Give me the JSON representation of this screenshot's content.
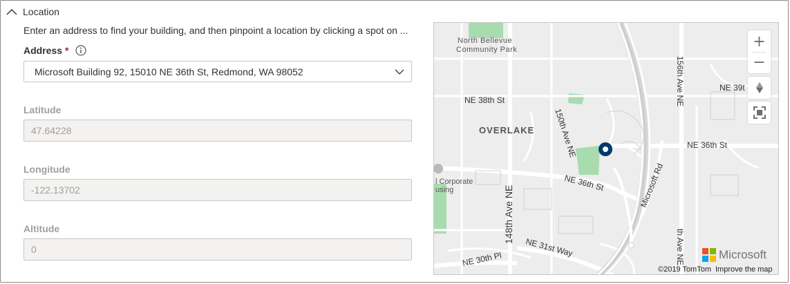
{
  "section": {
    "title": "Location",
    "expanded": true
  },
  "instructions": "Enter an address to find your building, and then pinpoint a location by clicking a spot on ...",
  "address": {
    "label": "Address",
    "required_mark": "*",
    "value": "Microsoft Building 92, 15010 NE 36th St, Redmond, WA 98052"
  },
  "latitude": {
    "label": "Latitude",
    "value": "47.64228"
  },
  "longitude": {
    "label": "Longitude",
    "value": "-122.13702"
  },
  "altitude": {
    "label": "Altitude",
    "value": "0"
  },
  "map": {
    "labels": {
      "park": "North Bellevue",
      "park2": "Community Park",
      "ne38": "NE 38th St",
      "overlake": "OVERLAKE",
      "ave150": "150th Ave NE",
      "ave148": "148th Ave NE",
      "ne36a": "NE 36th St",
      "ne36b": "NE 36th St",
      "ne39": "NE 39t",
      "ave156": "156th Ave NE",
      "ave156b": "th Ave NE",
      "msrd": "Microsoft Rd",
      "corp1": "l Corporate",
      "corp2": "using",
      "ne31": "NE 31st Way",
      "ne30": "NE 30th Pl"
    },
    "zoom_in": "+",
    "zoom_out": "−",
    "logo_text": "Microsoft",
    "copyright": "©2019 TomTom",
    "improve_link": "Improve the map"
  },
  "colors": {
    "accent_pin": "#003a6b",
    "required": "#a4262c",
    "park_green": "#a8dcae",
    "road": "#ffffff"
  }
}
